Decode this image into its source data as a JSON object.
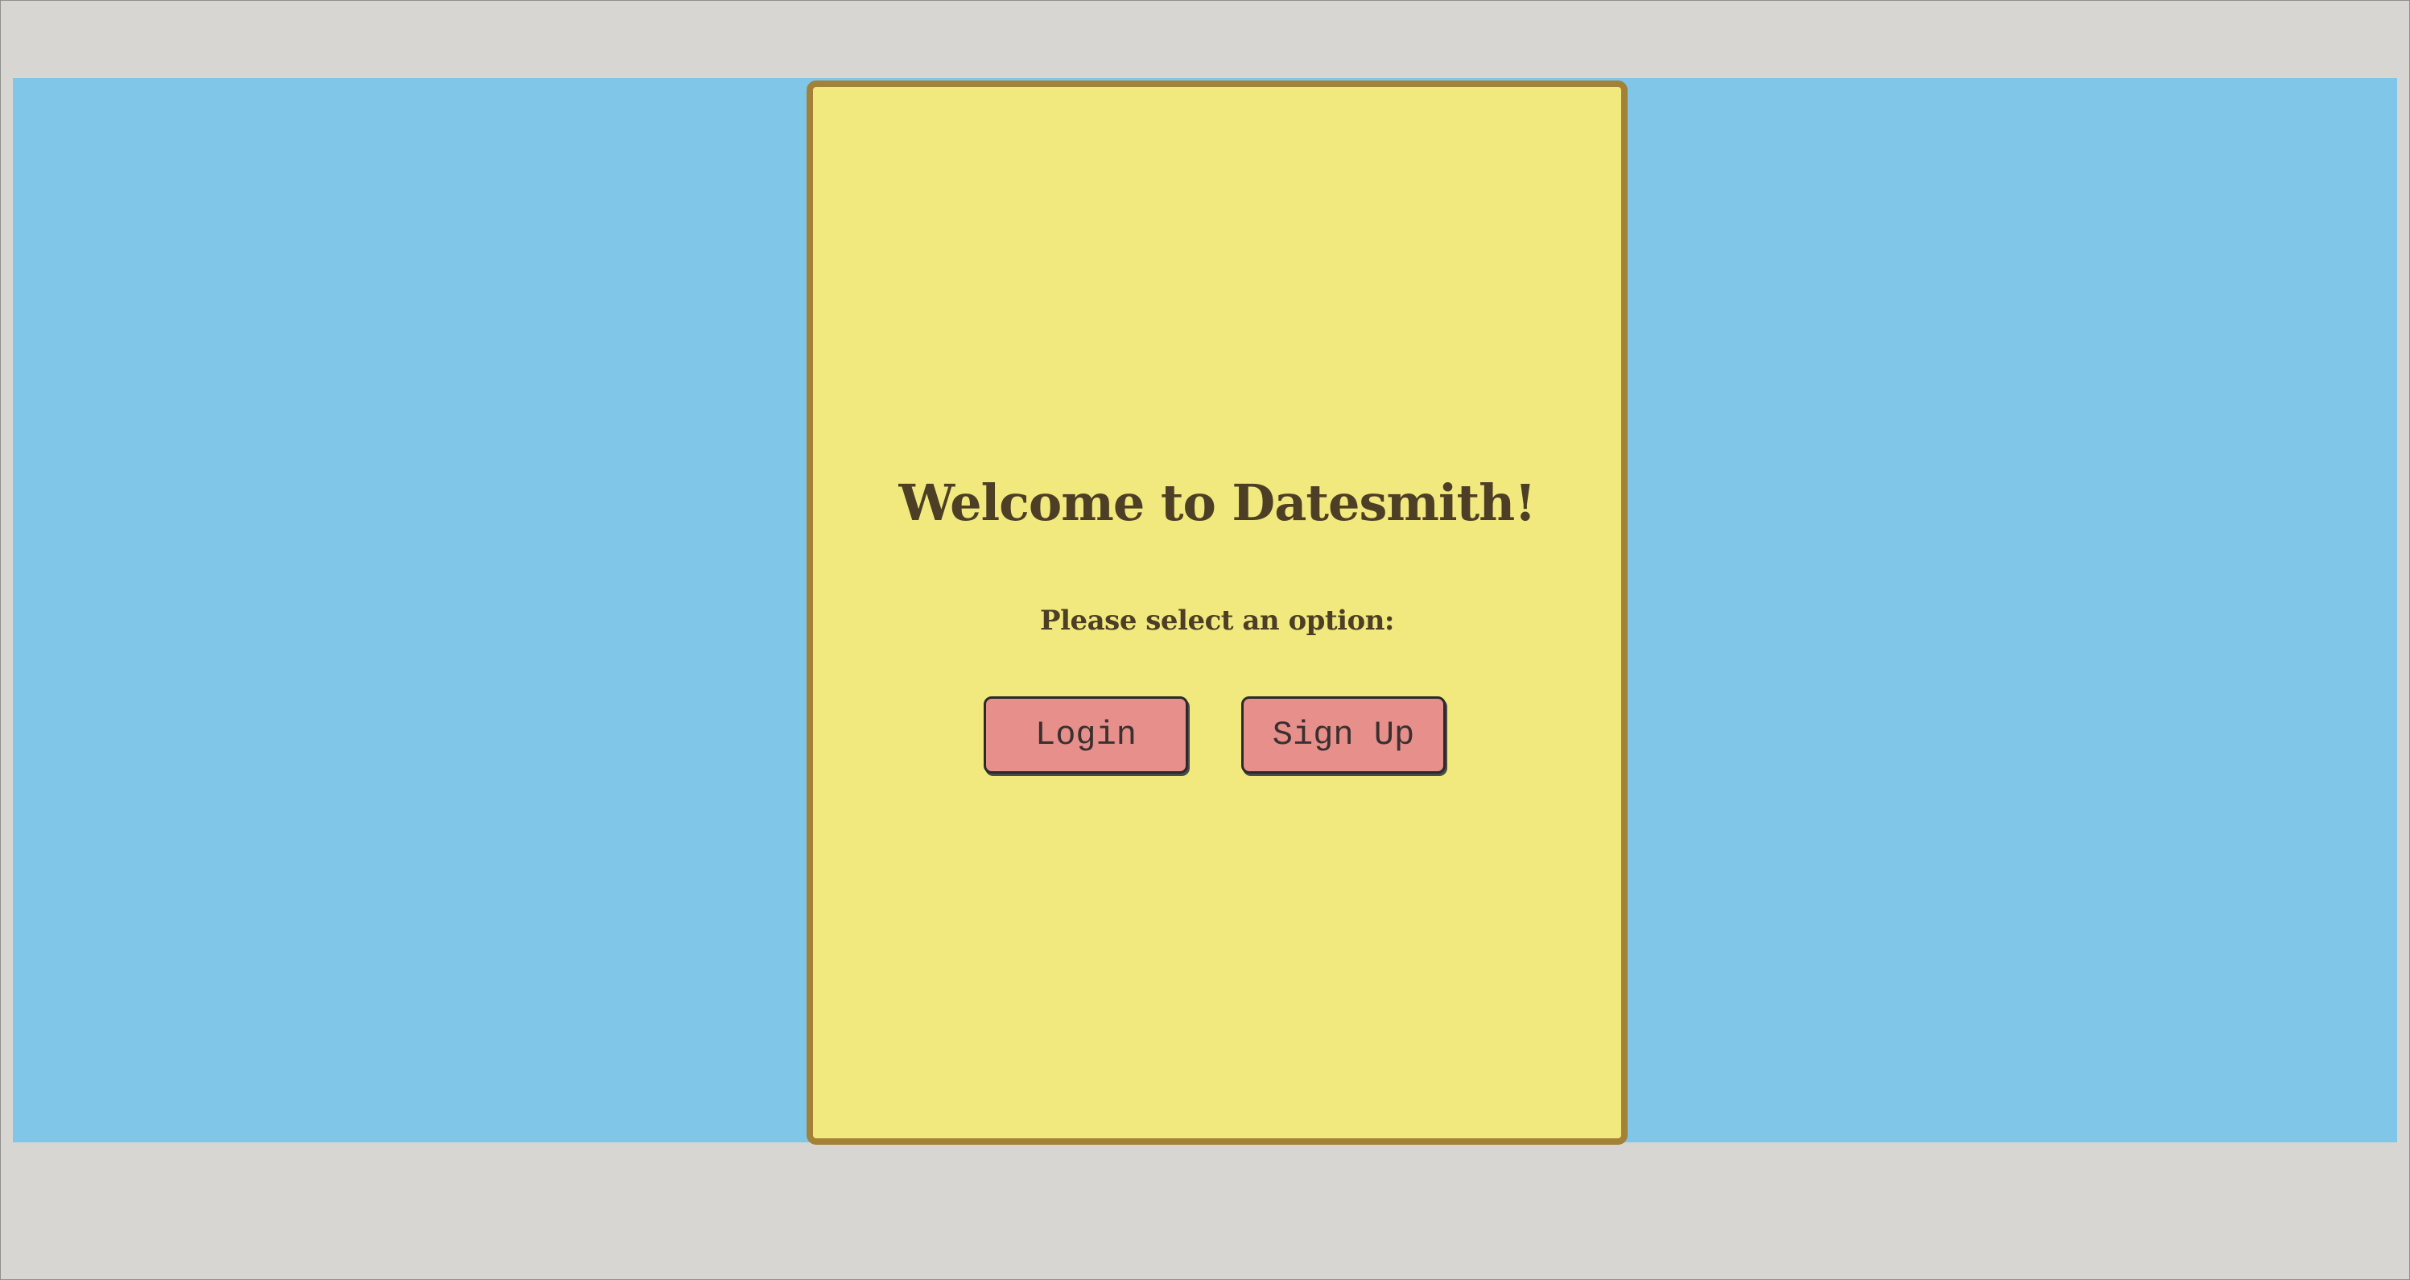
{
  "welcome": {
    "title": "Welcome to Datesmith!",
    "prompt": "Please select an option:"
  },
  "actions": {
    "login_label": "Login",
    "signup_label": "Sign Up"
  },
  "colors": {
    "page_background": "#7fc6e8",
    "card_background": "#f2e97e",
    "card_border": "#a38238",
    "button_background": "#e78f8b",
    "text": "#4d3f26"
  }
}
